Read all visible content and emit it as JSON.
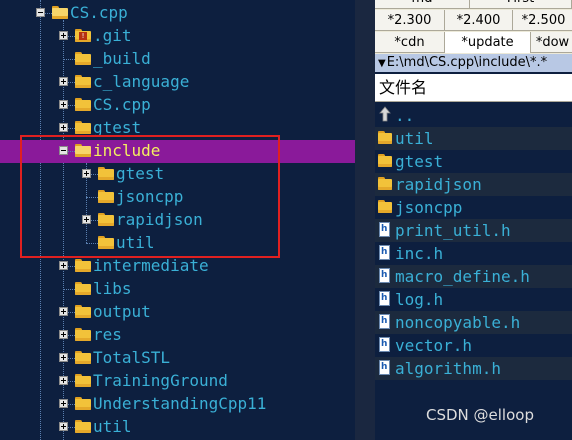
{
  "tree": {
    "items": [
      {
        "label": "CS.cpp",
        "state": "minus",
        "depth": 0
      },
      {
        "label": ".git",
        "state": "plus",
        "depth": 1,
        "icon": "folder-warning-icon"
      },
      {
        "label": "_build",
        "state": "none",
        "depth": 1
      },
      {
        "label": "c_language",
        "state": "plus",
        "depth": 1
      },
      {
        "label": "CS.cpp",
        "state": "plus",
        "depth": 1
      },
      {
        "label": "gtest",
        "state": "plus",
        "depth": 1
      },
      {
        "label": "include",
        "state": "minus",
        "depth": 1,
        "selected": true
      },
      {
        "label": "gtest",
        "state": "plus",
        "depth": 2
      },
      {
        "label": "jsoncpp",
        "state": "none",
        "depth": 2
      },
      {
        "label": "rapidjson",
        "state": "plus",
        "depth": 2
      },
      {
        "label": "util",
        "state": "none",
        "depth": 2
      },
      {
        "label": "intermediate",
        "state": "plus",
        "depth": 1
      },
      {
        "label": "libs",
        "state": "none",
        "depth": 1
      },
      {
        "label": "output",
        "state": "plus",
        "depth": 1
      },
      {
        "label": "res",
        "state": "plus",
        "depth": 1
      },
      {
        "label": "TotalSTL",
        "state": "plus",
        "depth": 1
      },
      {
        "label": "TrainingGround",
        "state": "plus",
        "depth": 1
      },
      {
        "label": "UnderstandingCpp11",
        "state": "plus",
        "depth": 1
      },
      {
        "label": "util",
        "state": "plus",
        "depth": 1
      }
    ]
  },
  "right": {
    "top_row": [
      "md",
      "First"
    ],
    "versions": [
      "*2.300",
      "*2.400",
      "*2.500"
    ],
    "tabs": [
      "*cdn",
      "*update",
      "*dow"
    ],
    "active_tab": 1,
    "path": "E:\\md\\CS.cpp\\include\\*.*",
    "column_header": "文件名",
    "files": [
      {
        "name": "..",
        "type": "up"
      },
      {
        "name": "util",
        "type": "folder"
      },
      {
        "name": "gtest",
        "type": "folder"
      },
      {
        "name": "rapidjson",
        "type": "folder"
      },
      {
        "name": "jsoncpp",
        "type": "folder"
      },
      {
        "name": "print_util.h",
        "type": "header"
      },
      {
        "name": "inc.h",
        "type": "header"
      },
      {
        "name": "macro_define.h",
        "type": "header"
      },
      {
        "name": "log.h",
        "type": "header"
      },
      {
        "name": "noncopyable.h",
        "type": "header"
      },
      {
        "name": "vector.h",
        "type": "header"
      },
      {
        "name": "algorithm.h",
        "type": "header"
      }
    ]
  },
  "watermark": "CSDN @elloop",
  "colors": {
    "tree_bg": "#0d1f3f",
    "label": "#3ab0d6",
    "selection": "#8a1a9a",
    "selected_text": "#f4f060",
    "highlight_box": "#e02020"
  }
}
